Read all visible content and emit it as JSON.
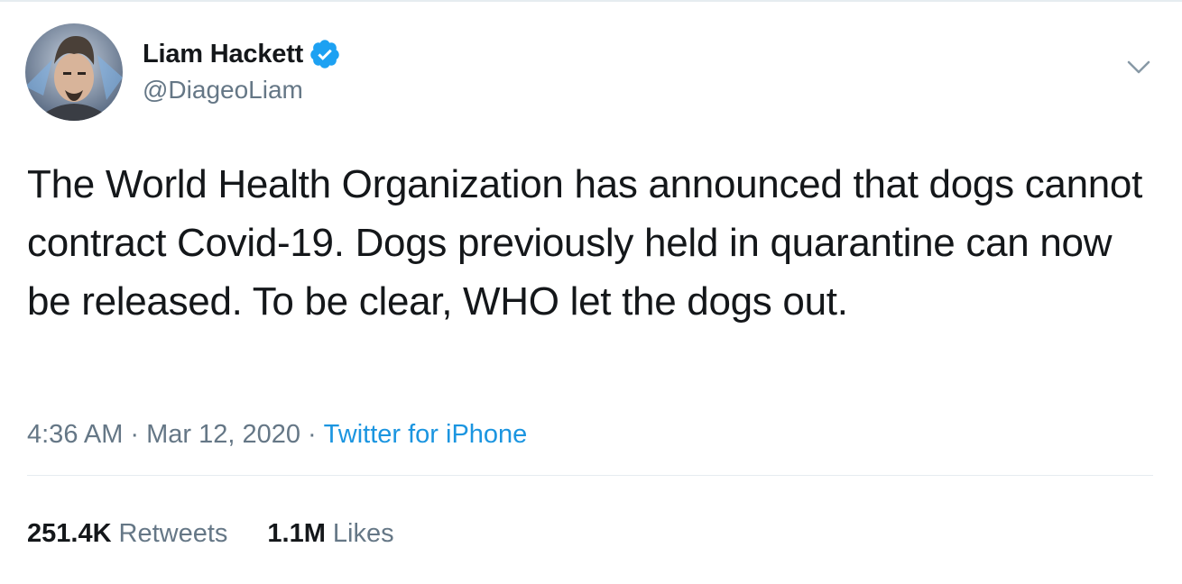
{
  "tweet": {
    "author": {
      "display_name": "Liam Hackett",
      "handle": "@DiageoLiam",
      "verified": true
    },
    "text": "The World Health Organization has announced that dogs cannot contract Covid-19. Dogs previously held in quarantine can now be released. To be clear, WHO let the dogs out.",
    "time": "4:36 AM",
    "separator": "·",
    "date": "Mar 12, 2020",
    "source": "Twitter for iPhone",
    "retweets": {
      "count": "251.4K",
      "label": "Retweets"
    },
    "likes": {
      "count": "1.1M",
      "label": "Likes"
    }
  },
  "icons": {
    "verified": "verified-badge-icon",
    "menu": "chevron-down-icon"
  },
  "colors": {
    "text_primary": "#14171a",
    "text_secondary": "#657786",
    "link": "#1b95e0",
    "verified": "#1da1f2",
    "divider": "#e6ecf0"
  }
}
